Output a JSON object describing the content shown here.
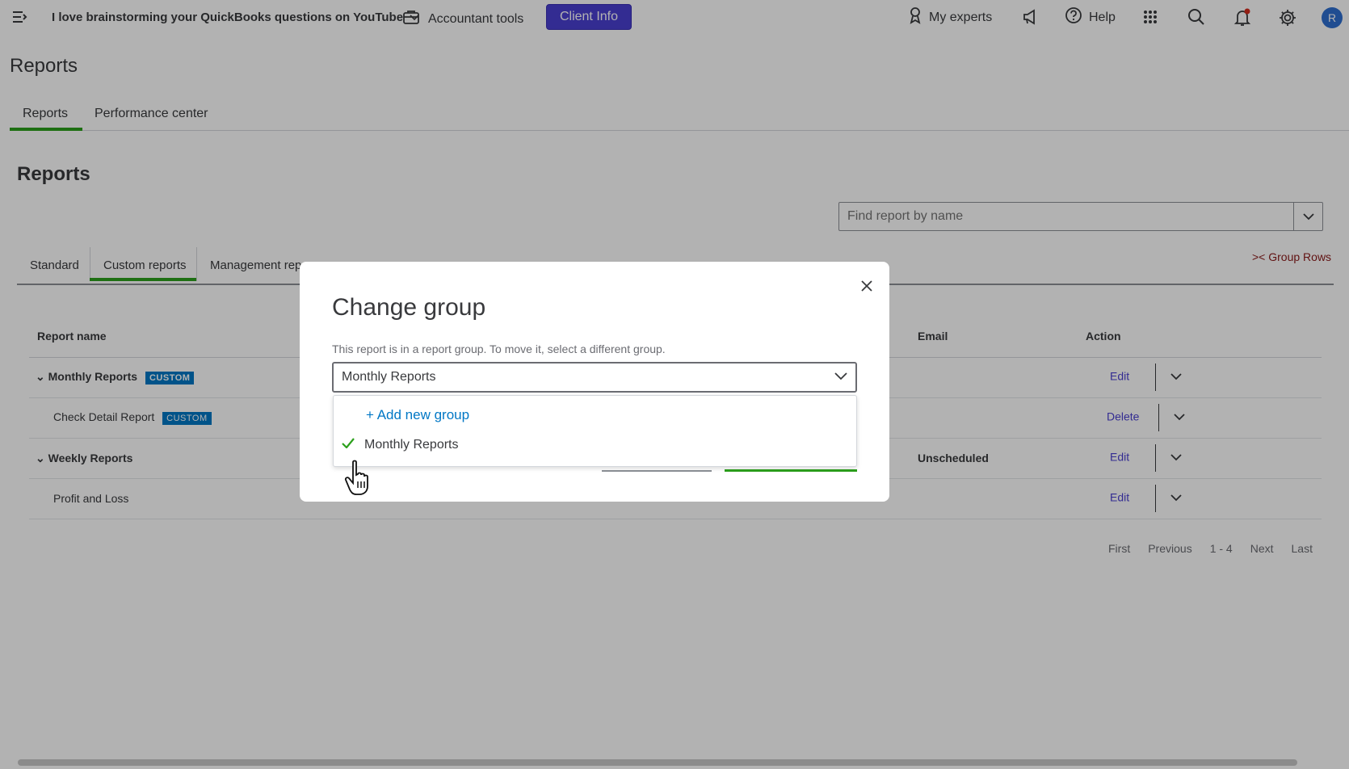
{
  "topbar": {
    "company_name": "I love brainstorming your QuickBooks questions on YouTube",
    "accountant_tools": "Accountant tools",
    "client_info": "Client Info",
    "my_experts": "My experts",
    "help": "Help",
    "avatar_initial": "R"
  },
  "page": {
    "title": "Reports",
    "tabs": [
      "Reports",
      "Performance center"
    ]
  },
  "reports_section": {
    "title": "Reports",
    "search_placeholder": "Find report by name",
    "tabs": [
      "Standard",
      "Custom reports",
      "Management rep"
    ],
    "group_rows": ">< Group Rows"
  },
  "table": {
    "headers": [
      "Report name",
      "Email",
      "Action"
    ],
    "rows": [
      {
        "name": "Monthly Reports",
        "badge": "CUSTOM",
        "email": "",
        "action": "Edit"
      },
      {
        "name": "Check Detail Report",
        "badge": "CUSTOM",
        "email": "",
        "action": "Delete"
      },
      {
        "name": "Weekly Reports",
        "badge": "",
        "email": "Unscheduled",
        "action": "Edit"
      },
      {
        "name": "Profit and Loss",
        "badge": "",
        "email": "",
        "action": "Edit"
      }
    ]
  },
  "pager": {
    "first": "First",
    "previous": "Previous",
    "range": "1 - 4",
    "next": "Next",
    "last": "Last"
  },
  "modal": {
    "title": "Change group",
    "description": "This report is in a report group. To move it, select a different group.",
    "selected": "Monthly Reports",
    "options": {
      "add_new": "+ Add new group",
      "monthly": "Monthly Reports"
    }
  },
  "colors": {
    "accent_green": "#2ca01c",
    "client_info_bg": "#4a3fd1",
    "link_blue": "#0077c5",
    "badge_blue": "#0077c5"
  }
}
